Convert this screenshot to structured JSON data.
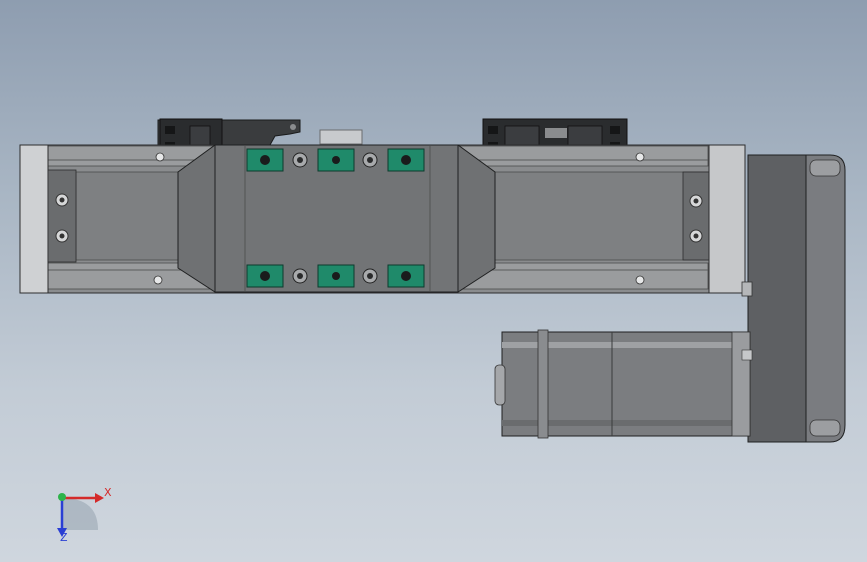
{
  "triad": {
    "x_label": "X",
    "z_label": "Z",
    "x_color": "#d42a2a",
    "y_color": "#2db34a",
    "z_color": "#2a3fd4"
  },
  "colors": {
    "background_top": "#8e9db0",
    "background_bottom": "#cfd6de",
    "rail_body": "#8a8c8e",
    "carriage": "#6f7173",
    "slider_block": "#1f8a6a",
    "motor_body": "#7b7d80",
    "motor_flange": "#5e6063",
    "sensor_bracket": "#2e3033"
  }
}
